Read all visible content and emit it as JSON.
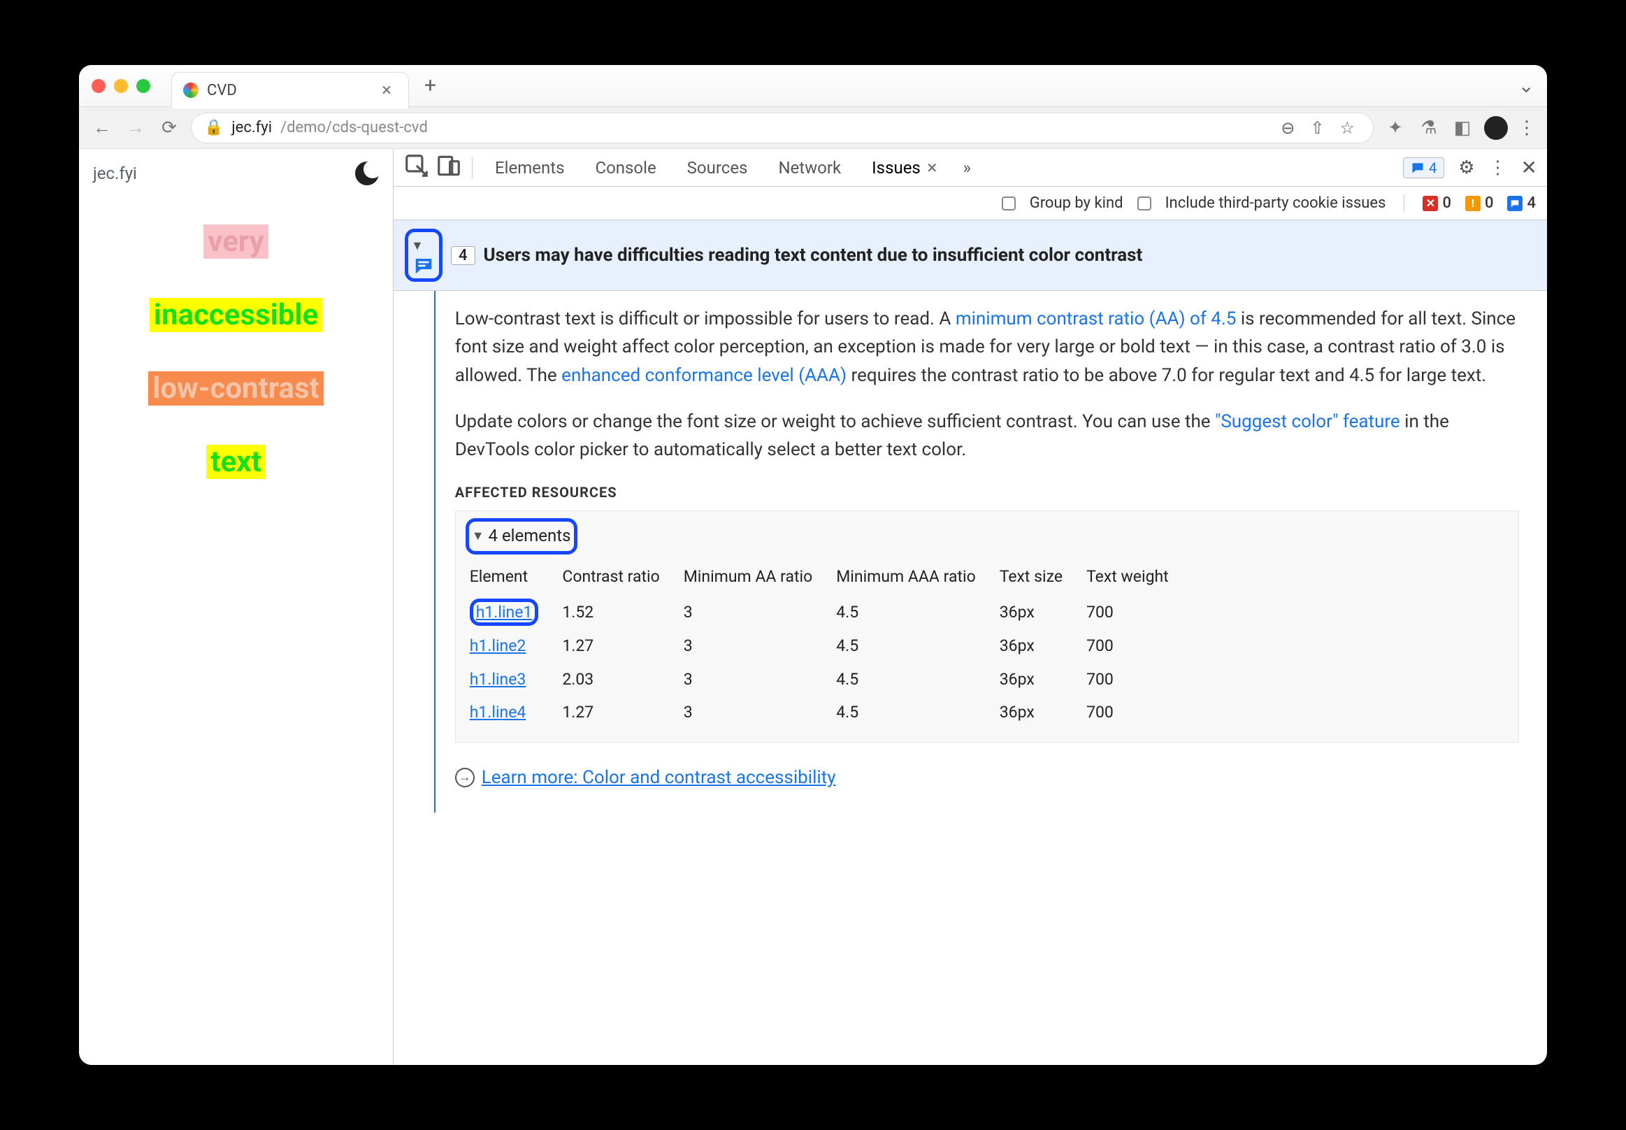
{
  "browser": {
    "tab_title": "CVD",
    "url_host": "jec.fyi",
    "url_path": "/demo/cds-quest-cvd"
  },
  "page": {
    "site_label": "jec.fyi",
    "words": [
      "very",
      "inaccessible",
      "low-contrast",
      "text"
    ]
  },
  "devtools": {
    "tabs": [
      "Elements",
      "Console",
      "Sources",
      "Network",
      "Issues"
    ],
    "messages_badge": "4",
    "issues_bar": {
      "group_label": "Group by kind",
      "third_party_label": "Include third-party cookie issues",
      "errors": "0",
      "warnings": "0",
      "issues": "4"
    },
    "issue": {
      "count": "4",
      "title": "Users may have difficulties reading text content due to insufficient color contrast",
      "para1_a": "Low-contrast text is difficult or impossible for users to read. A ",
      "link_aa": "minimum contrast ratio (AA) of 4.5",
      "para1_b": " is recommended for all text. Since font size and weight affect color perception, an exception is made for very large or bold text — in this case, a contrast ratio of 3.0 is allowed. The ",
      "link_aaa": "enhanced conformance level (AAA)",
      "para1_c": " requires the contrast ratio to be above 7.0 for regular text and 4.5 for large text.",
      "para2_a": "Update colors or change the font size or weight to achieve sufficient contrast. You can use the ",
      "link_suggest": "\"Suggest color\" feature",
      "para2_b": " in the DevTools color picker to automatically select a better text color.",
      "affected_label": "AFFECTED RESOURCES",
      "elements_toggle": "4 elements",
      "columns": [
        "Element",
        "Contrast ratio",
        "Minimum AA ratio",
        "Minimum AAA ratio",
        "Text size",
        "Text weight"
      ],
      "rows": [
        {
          "el": "h1.line1",
          "cr": "1.52",
          "aa": "3",
          "aaa": "4.5",
          "size": "36px",
          "weight": "700"
        },
        {
          "el": "h1.line2",
          "cr": "1.27",
          "aa": "3",
          "aaa": "4.5",
          "size": "36px",
          "weight": "700"
        },
        {
          "el": "h1.line3",
          "cr": "2.03",
          "aa": "3",
          "aaa": "4.5",
          "size": "36px",
          "weight": "700"
        },
        {
          "el": "h1.line4",
          "cr": "1.27",
          "aa": "3",
          "aaa": "4.5",
          "size": "36px",
          "weight": "700"
        }
      ],
      "learn_more": "Learn more: Color and contrast accessibility"
    }
  }
}
